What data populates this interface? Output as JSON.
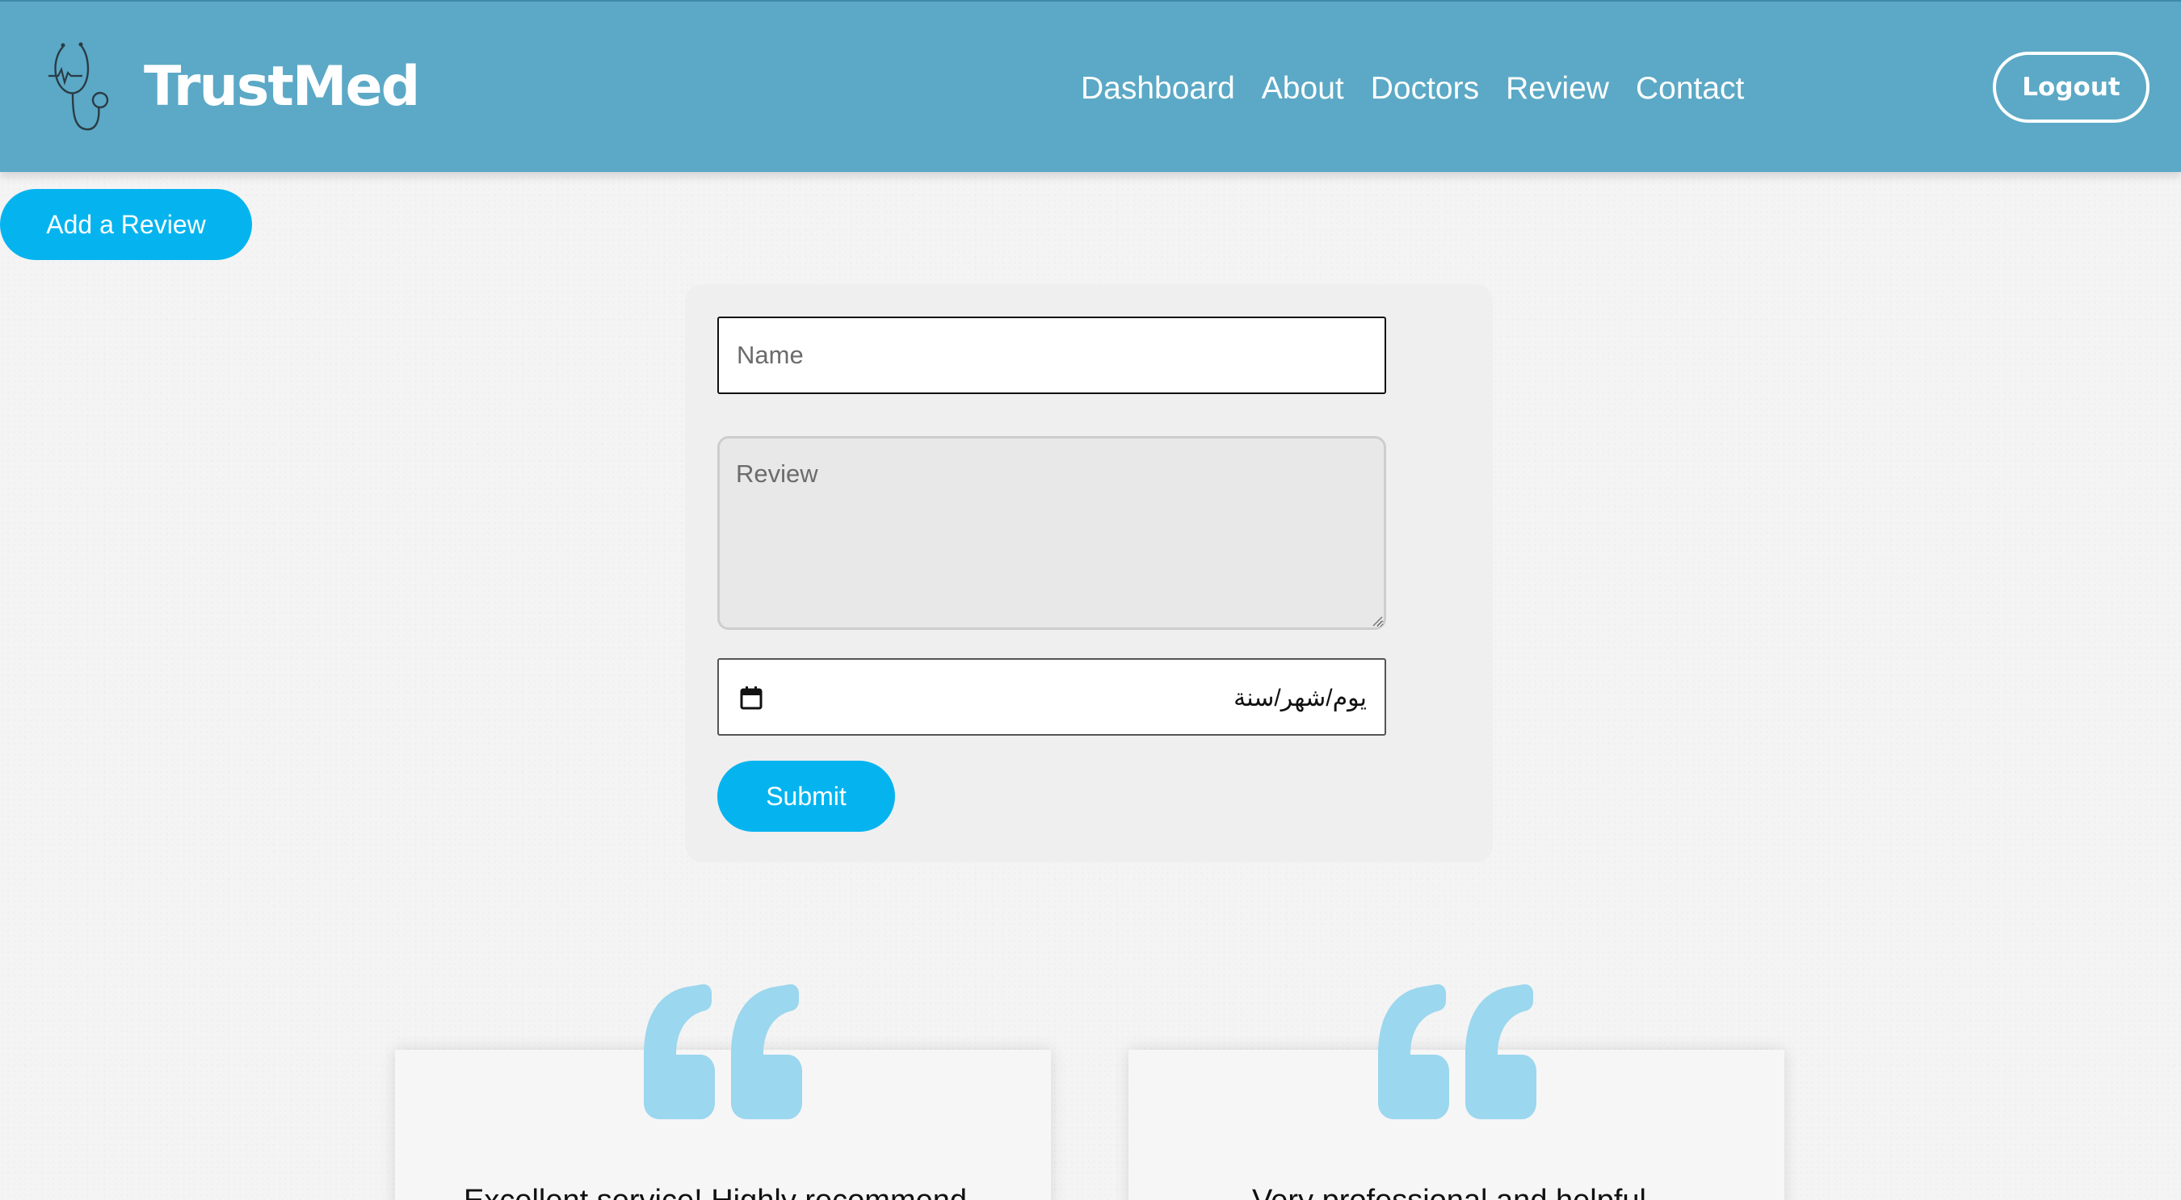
{
  "header": {
    "brand": "TrustMed",
    "nav": [
      "Dashboard",
      "About",
      "Doctors",
      "Review",
      "Contact"
    ],
    "logout_label": "Logout"
  },
  "add_review_label": "Add a Review",
  "form": {
    "name_placeholder": "Name",
    "review_placeholder": "Review",
    "date_display": "يوم/شهر/سنة",
    "submit_label": "Submit"
  },
  "testimonials": [
    {
      "text": "Excellent service! Highly recommend"
    },
    {
      "text": "Very professional and helpful"
    }
  ],
  "colors": {
    "header_bg": "#5ba9c6",
    "accent": "#05b4ef",
    "quote": "#9bd7ee"
  }
}
